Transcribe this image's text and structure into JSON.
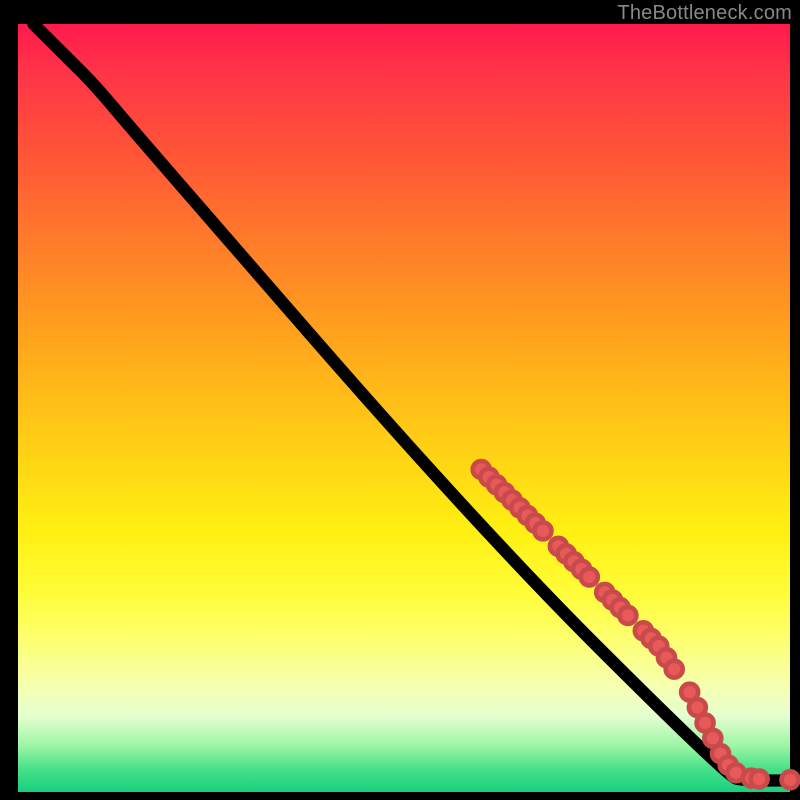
{
  "attribution": "TheBottleneck.com",
  "colors": {
    "gradient_top": "#ff1a4d",
    "gradient_mid": "#ffd814",
    "gradient_bottom": "#17d07e",
    "marker": "#e85a5a",
    "line": "#000000"
  },
  "chart_data": {
    "type": "line",
    "title": "",
    "xlabel": "",
    "ylabel": "",
    "xlim": [
      0,
      100
    ],
    "ylim": [
      0,
      100
    ],
    "grid": false,
    "legend": false,
    "curve": [
      {
        "x": 2,
        "y": 100
      },
      {
        "x": 6,
        "y": 96
      },
      {
        "x": 10,
        "y": 92
      },
      {
        "x": 15,
        "y": 86
      },
      {
        "x": 60,
        "y": 34
      },
      {
        "x": 92,
        "y": 2
      },
      {
        "x": 94,
        "y": 1.5
      },
      {
        "x": 100,
        "y": 1.5
      }
    ],
    "markers": [
      {
        "x": 60,
        "y": 42
      },
      {
        "x": 61,
        "y": 41
      },
      {
        "x": 62,
        "y": 40
      },
      {
        "x": 63,
        "y": 39
      },
      {
        "x": 64,
        "y": 38
      },
      {
        "x": 65,
        "y": 37
      },
      {
        "x": 66,
        "y": 36
      },
      {
        "x": 67,
        "y": 35
      },
      {
        "x": 68,
        "y": 34
      },
      {
        "x": 70,
        "y": 32
      },
      {
        "x": 71,
        "y": 31
      },
      {
        "x": 72,
        "y": 30
      },
      {
        "x": 73,
        "y": 29
      },
      {
        "x": 74,
        "y": 28
      },
      {
        "x": 76,
        "y": 26
      },
      {
        "x": 77,
        "y": 25
      },
      {
        "x": 78,
        "y": 24
      },
      {
        "x": 79,
        "y": 23
      },
      {
        "x": 81,
        "y": 21
      },
      {
        "x": 82,
        "y": 20
      },
      {
        "x": 83,
        "y": 19
      },
      {
        "x": 84,
        "y": 17.5
      },
      {
        "x": 85,
        "y": 16
      },
      {
        "x": 87,
        "y": 13
      },
      {
        "x": 88,
        "y": 11
      },
      {
        "x": 89,
        "y": 9
      },
      {
        "x": 90,
        "y": 7
      },
      {
        "x": 91,
        "y": 5
      },
      {
        "x": 92,
        "y": 3.5
      },
      {
        "x": 93,
        "y": 2.5
      },
      {
        "x": 95,
        "y": 1.8
      },
      {
        "x": 96,
        "y": 1.7
      },
      {
        "x": 100,
        "y": 1.6
      }
    ],
    "marker_radius": 1.1
  }
}
